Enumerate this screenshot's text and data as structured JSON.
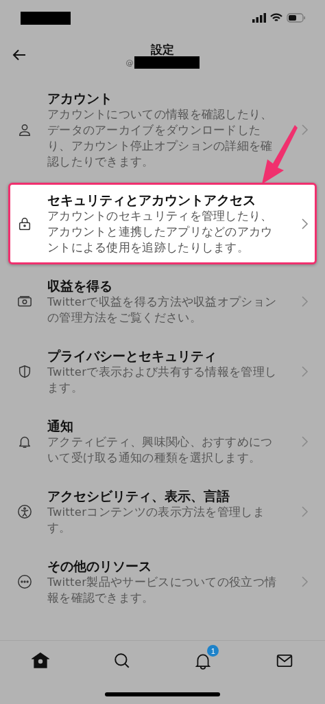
{
  "header": {
    "title": "設定",
    "handle_prefix": "@"
  },
  "items": [
    {
      "title": "アカウント",
      "description": "アカウントについての情報を確認したり、データのアーカイブをダウンロードしたり、アカウント停止オプションの詳細を確認したりできます。",
      "highlighted": false
    },
    {
      "title": "セキュリティとアカウントアクセス",
      "description": "アカウントのセキュリティを管理したり、アカウントと連携したアプリなどのアカウントによる使用を追跡したりします。",
      "highlighted": true
    },
    {
      "title": "収益を得る",
      "description": "Twitterで収益を得る方法や収益オプションの管理方法をご覧ください。",
      "highlighted": false
    },
    {
      "title": "プライバシーとセキュリティ",
      "description": "Twitterで表示および共有する情報を管理します。",
      "highlighted": false
    },
    {
      "title": "通知",
      "description": "アクティビティ、興味関心、おすすめについて受け取る通知の種類を選択します。",
      "highlighted": false
    },
    {
      "title": "アクセシビリティ、表示、言語",
      "description": "Twitterコンテンツの表示方法を管理します。",
      "highlighted": false
    },
    {
      "title": "その他のリソース",
      "description": "Twitter製品やサービスについての役立つ情報を確認できます。",
      "highlighted": false
    }
  ],
  "tabbar": [
    {
      "selected": true
    },
    {
      "selected": false
    },
    {
      "selected": false,
      "badge": "1"
    },
    {
      "selected": false
    }
  ]
}
